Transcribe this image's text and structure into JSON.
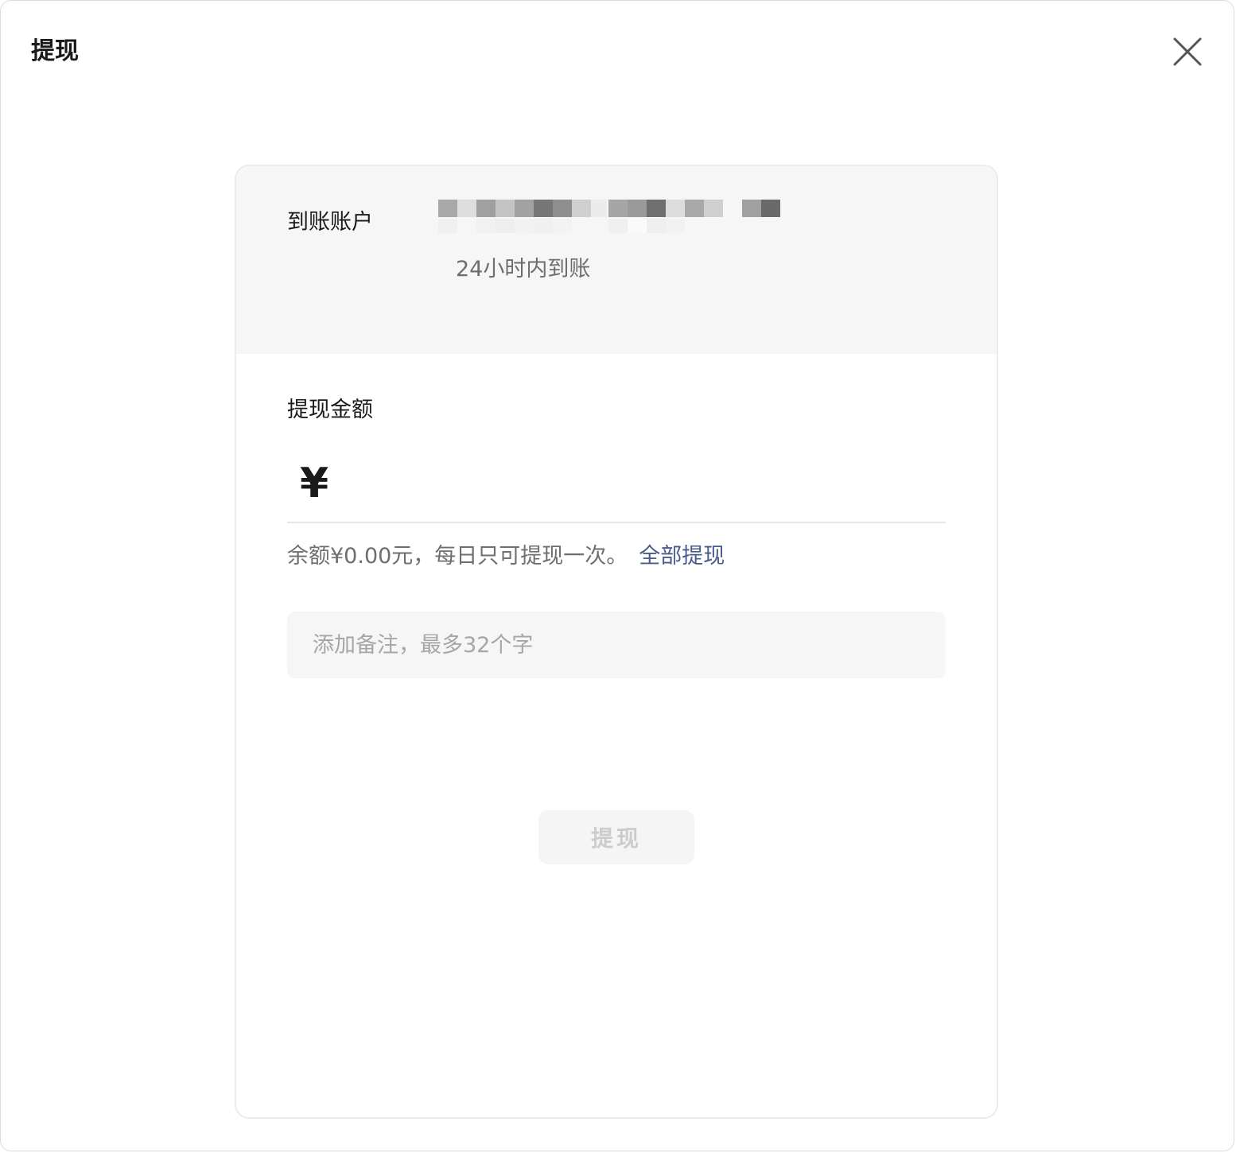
{
  "dialog": {
    "title": "提现",
    "close_icon": "close-icon"
  },
  "account": {
    "label": "到账账户",
    "arrival_note": "24小时内到账"
  },
  "amount": {
    "label": "提现金额",
    "currency_symbol": "¥",
    "value": ""
  },
  "balance": {
    "text": "余额¥0.00元，每日只可提现一次。",
    "withdraw_all_label": "全部提现"
  },
  "remark": {
    "placeholder": "添加备注，最多32个字",
    "value": ""
  },
  "submit": {
    "label": "提现",
    "enabled": false
  },
  "colors": {
    "link": "#4a5b8a",
    "section_bg": "#f6f6f6",
    "disabled_text": "#cccccc"
  }
}
